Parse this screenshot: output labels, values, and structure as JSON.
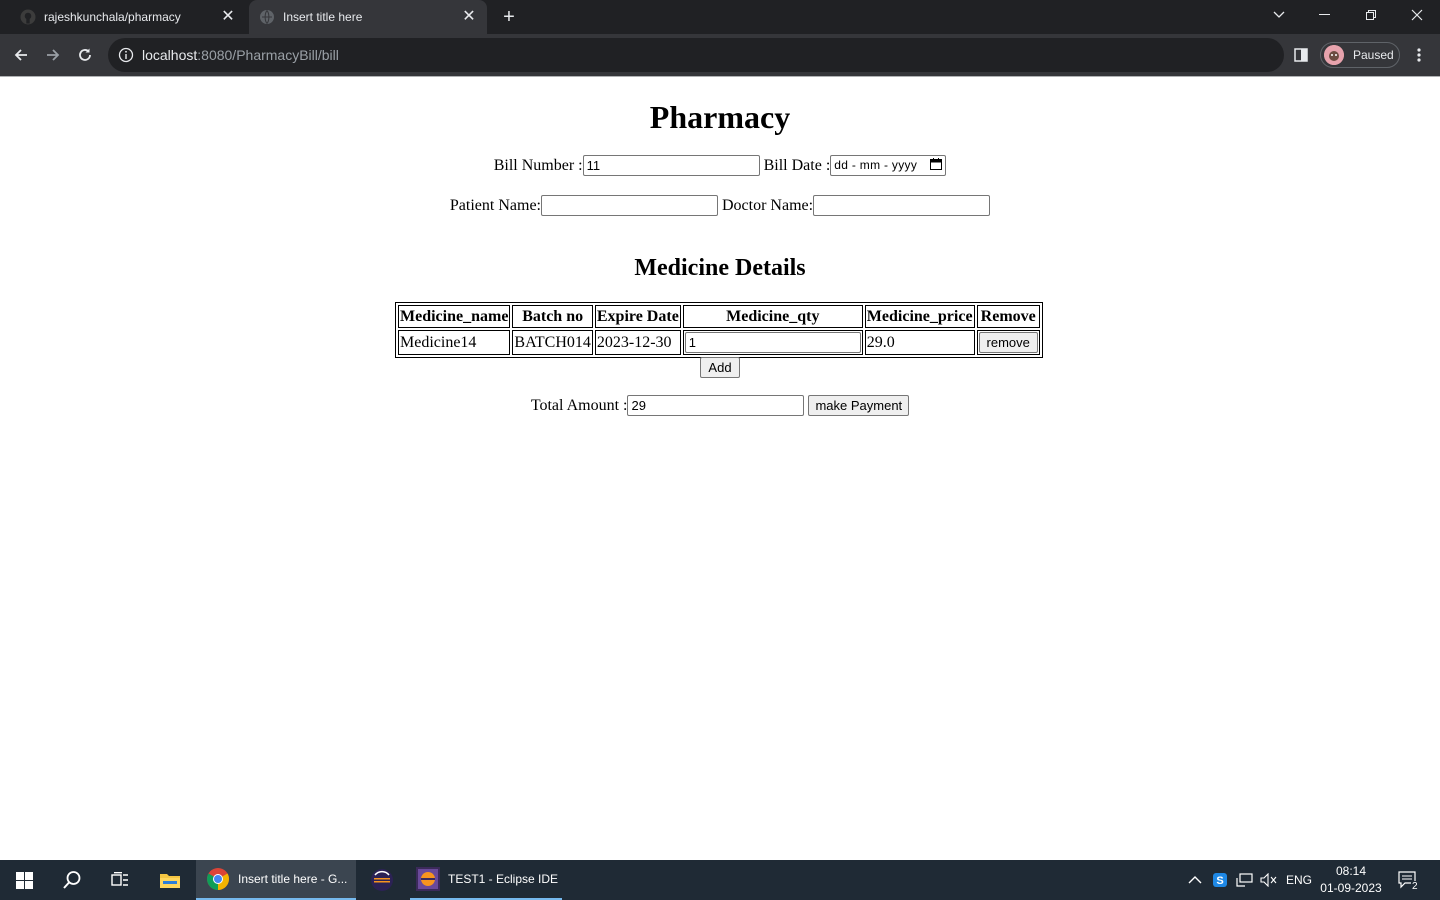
{
  "browser": {
    "tabs": [
      {
        "title": "rajeshkunchala/pharmacy",
        "active": false,
        "favicon": "github-icon"
      },
      {
        "title": "Insert title here",
        "active": true,
        "favicon": "globe-icon"
      }
    ],
    "url": {
      "host": "localhost",
      "path": ":8080/PharmacyBill/bill"
    },
    "profile_label": "Paused"
  },
  "page": {
    "title": "Pharmacy",
    "bill_number_label": "Bill Number :",
    "bill_number_value": "11",
    "bill_date_label": "Bill Date :",
    "bill_date_placeholder": "dd - mm - yyyy",
    "patient_name_label": "Patient Name:",
    "patient_name_value": "",
    "doctor_name_label": "Doctor Name:",
    "doctor_name_value": "",
    "section_title": "Medicine Details",
    "table": {
      "headers": [
        "Medicine_name",
        "Batch no",
        "Expire Date",
        "Medicine_qty",
        "Medicine_price",
        "Remove"
      ],
      "rows": [
        {
          "name": "Medicine14",
          "batch": "BATCH014",
          "expire": "2023-12-30",
          "qty": "1",
          "price": "29.0",
          "remove_label": "remove"
        }
      ]
    },
    "add_label": "Add",
    "total_label": "Total Amount :",
    "total_value": "29",
    "pay_label": "make Payment"
  },
  "taskbar": {
    "apps": [
      {
        "label": "Insert title here - G...",
        "icon": "chrome-icon"
      },
      {
        "label": "TEST1 - Eclipse IDE",
        "icon": "eclipse-icon"
      }
    ],
    "language": "ENG",
    "time": "08:14",
    "date": "01-09-2023",
    "notification_count": "2"
  },
  "colors": {
    "tabstrip_bg": "#202124",
    "toolbar_bg": "#35363a",
    "taskbar_bg": "#1f2a35",
    "taskbar_accent": "#76b9ed"
  }
}
